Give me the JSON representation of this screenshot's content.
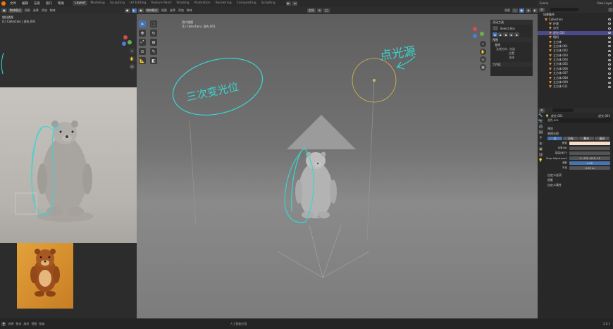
{
  "menu": [
    "文件",
    "编辑",
    "渲染",
    "窗口",
    "帮助"
  ],
  "workspaces": [
    "Layout",
    "Modeling",
    "Sculpting",
    "UV Editing",
    "Texture Paint",
    "Shading",
    "Animation",
    "Rendering",
    "Compositing",
    "Scripting"
  ],
  "active_workspace": "Layout",
  "scene": {
    "name": "Scene",
    "view_layer": "View Layer"
  },
  "left_header": {
    "mode": "物体模式",
    "view": "视图",
    "select": "选择",
    "add": "添加",
    "object": "物体"
  },
  "left_viewport": {
    "camera_title": "相机透视",
    "collection_path": "(1) Collection | 虎先.001"
  },
  "main_header": {
    "mode": "物体模式",
    "view": "视图",
    "select": "选择",
    "add": "添加",
    "object": "物体",
    "transform": "全局",
    "overlay_label": "视图"
  },
  "main_viewport": {
    "title": "用户透视",
    "collection_path": "(1) Collection | 虎先.001"
  },
  "annotations": {
    "left_text": "三次变光位",
    "right_text": "点光源"
  },
  "npanel": {
    "active_tool_header": "活动工具",
    "tool_name": "Select Box",
    "view_header": "视图",
    "sub_header": "变换",
    "row1_label": "法线方向",
    "row1_opt": "仅选",
    "row2_opt": "位置",
    "row3_opt": "法线",
    "workspace_header": "工作区",
    "tabs": [
      "项目",
      "工具",
      "视图",
      "Node Wrangler"
    ]
  },
  "outliner": {
    "search_placeholder": "",
    "header": "场景集合",
    "items": [
      {
        "name": "Collection",
        "selected": false,
        "indent": 0
      },
      {
        "name": "环境",
        "selected": false,
        "indent": 1
      },
      {
        "name": "点光",
        "selected": false,
        "indent": 1
      },
      {
        "name": "虎先.001",
        "selected": true,
        "indent": 1
      },
      {
        "name": "相机",
        "selected": false,
        "indent": 1
      },
      {
        "name": "立方体",
        "selected": false,
        "indent": 1
      },
      {
        "name": "立方体.001",
        "selected": false,
        "indent": 1
      },
      {
        "name": "立方体.002",
        "selected": false,
        "indent": 1
      },
      {
        "name": "立方体.003",
        "selected": false,
        "indent": 1
      },
      {
        "name": "立方体.004",
        "selected": false,
        "indent": 1
      },
      {
        "name": "立方体.005",
        "selected": false,
        "indent": 1
      },
      {
        "name": "立方体.006",
        "selected": false,
        "indent": 1
      },
      {
        "name": "立方体.007",
        "selected": false,
        "indent": 1
      },
      {
        "name": "立方体.008",
        "selected": false,
        "indent": 1
      },
      {
        "name": "立方体.009",
        "selected": false,
        "indent": 1
      },
      {
        "name": "立方体.011",
        "selected": false,
        "indent": 1
      }
    ]
  },
  "properties": {
    "object_name": "虎先.001",
    "data_name": "虎先.001",
    "section_preview": "预览",
    "section_light": "物理光照",
    "light_tabs": [
      "点",
      "日光",
      "聚光",
      "面光"
    ],
    "rows": [
      {
        "label": "颜色",
        "value": "",
        "type": "color"
      },
      {
        "label": "功率(W)",
        "value": "",
        "type": "field"
      },
      {
        "label": "能量(每个)",
        "value": "",
        "type": "field"
      },
      {
        "label": "Step Adjustment",
        "value": "-1  -0.5  +0.5  +1",
        "type": "field"
      },
      {
        "label": "漫射",
        "value": "1.00",
        "type": "blue"
      },
      {
        "label": "半径",
        "value": "0.25 m",
        "type": "field"
      }
    ],
    "section_custom": "自定义选项",
    "section_shadow": "阴影",
    "section_props": "自定义属性"
  },
  "status_bar": {
    "items": [
      "选择",
      "移动",
      "旋转",
      "视图",
      "物体"
    ],
    "center": "人工智能应用",
    "version": "3.6.1"
  },
  "colors": {
    "accent": "#4772b3",
    "selected_row": "#4a4a8a",
    "annotation": "#39d5d0",
    "light_circle": "#d8b84a",
    "light_color": "#f8dcc8"
  }
}
